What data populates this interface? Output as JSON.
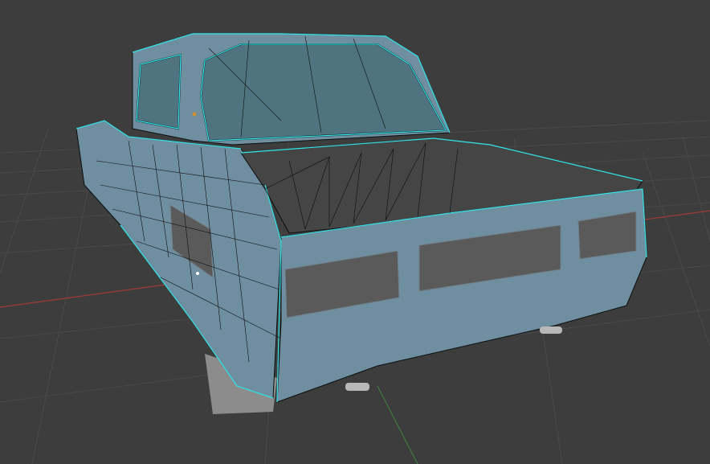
{
  "viewport": {
    "background": "#3d3d3d",
    "grid_color": "#4a4a4a",
    "x_axis_color": "#a23a3a",
    "y_axis_color": "#3f7a3f"
  },
  "model": {
    "body_color": "#6f8fa0",
    "glass_color": "#4f7480",
    "wire_color": "#0b0f10",
    "selected_edge_color": "#33e8ec",
    "tail_panel_color": "#5a5a5a",
    "shadow_panel_color": "#8c8c8c"
  },
  "chart_data": []
}
